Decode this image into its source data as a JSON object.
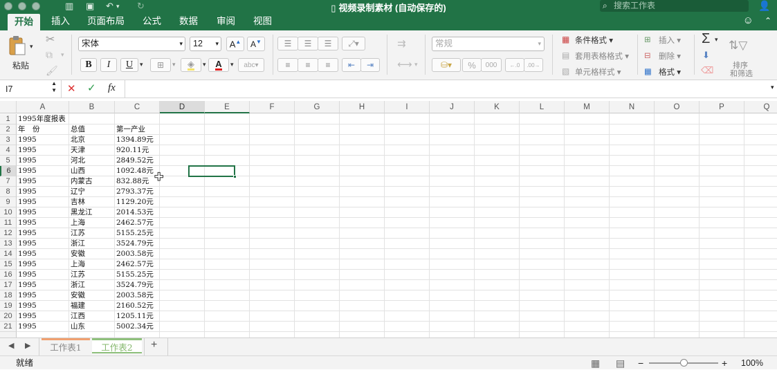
{
  "titlebar": {
    "title": "视频录制素材 (自动保存的)",
    "search_placeholder": "搜索工作表"
  },
  "ribbon_tabs": [
    "开始",
    "插入",
    "页面布局",
    "公式",
    "数据",
    "审阅",
    "视图"
  ],
  "active_tab_index": 0,
  "ribbon": {
    "paste_label": "粘贴",
    "font_name": "宋体",
    "font_size": "12",
    "bold": "B",
    "italic": "I",
    "underline": "U",
    "font_color": "#e02020",
    "number_format": "常规",
    "percent": "%",
    "thousands": "000",
    "conditional_format": "条件格式",
    "table_format": "套用表格格式",
    "cell_styles": "单元格样式",
    "insert": "插入",
    "delete": "删除",
    "format": "格式",
    "sort_filter_line1": "排序",
    "sort_filter_line2": "和筛选"
  },
  "formula_bar": {
    "name_box": "I7",
    "fx": "fx",
    "value": ""
  },
  "columns": [
    "A",
    "B",
    "C",
    "D",
    "E",
    "F",
    "G",
    "H",
    "I",
    "J",
    "K",
    "L",
    "M",
    "N",
    "O",
    "P",
    "Q"
  ],
  "active_column": "D",
  "active_row": "6",
  "sheet_rows": [
    {
      "n": "1",
      "a": "1995年度报表",
      "b": "",
      "c": ""
    },
    {
      "n": "2",
      "a": "年　份",
      "b": "总值",
      "c": "第一产业"
    },
    {
      "n": "3",
      "a": "1995",
      "b": "北京",
      "c": "1394.89元"
    },
    {
      "n": "4",
      "a": "1995",
      "b": "天津",
      "c": "920.11元"
    },
    {
      "n": "5",
      "a": "1995",
      "b": "河北",
      "c": "2849.52元"
    },
    {
      "n": "6",
      "a": "1995",
      "b": "山西",
      "c": "1092.48元"
    },
    {
      "n": "7",
      "a": "1995",
      "b": "内蒙古",
      "c": "832.88元"
    },
    {
      "n": "8",
      "a": "1995",
      "b": "辽宁",
      "c": "2793.37元"
    },
    {
      "n": "9",
      "a": "1995",
      "b": "吉林",
      "c": "1129.20元"
    },
    {
      "n": "10",
      "a": "1995",
      "b": "黑龙江",
      "c": "2014.53元"
    },
    {
      "n": "11",
      "a": "1995",
      "b": "上海",
      "c": "2462.57元"
    },
    {
      "n": "12",
      "a": "1995",
      "b": "江苏",
      "c": "5155.25元"
    },
    {
      "n": "13",
      "a": "1995",
      "b": "浙江",
      "c": "3524.79元"
    },
    {
      "n": "14",
      "a": "1995",
      "b": "安徽",
      "c": "2003.58元"
    },
    {
      "n": "15",
      "a": "1995",
      "b": "上海",
      "c": "2462.57元"
    },
    {
      "n": "16",
      "a": "1995",
      "b": "江苏",
      "c": "5155.25元"
    },
    {
      "n": "17",
      "a": "1995",
      "b": "浙江",
      "c": "3524.79元"
    },
    {
      "n": "18",
      "a": "1995",
      "b": "安徽",
      "c": "2003.58元"
    },
    {
      "n": "19",
      "a": "1995",
      "b": "福建",
      "c": "2160.52元"
    },
    {
      "n": "20",
      "a": "1995",
      "b": "江西",
      "c": "1205.11元"
    },
    {
      "n": "21",
      "a": "1995",
      "b": "山东",
      "c": "5002.34元"
    }
  ],
  "sheets": [
    "工作表1",
    "工作表2"
  ],
  "active_sheet_index": 1,
  "add_sheet": "+",
  "status": {
    "text": "就绪",
    "zoom": "100%",
    "zoom_fraction": 0.5
  },
  "colors": {
    "brand": "#217346",
    "selection": "#217346",
    "sheet1_tab": "#f0a070",
    "sheet2_tab": "#8ec07c"
  }
}
